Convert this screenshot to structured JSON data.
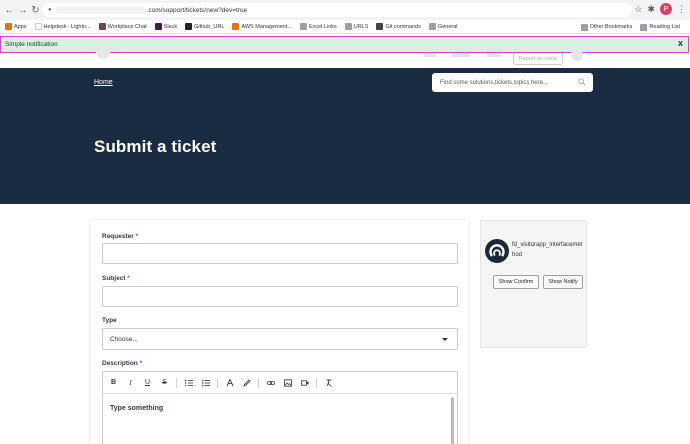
{
  "browser": {
    "url_visible": ".com/support/tickets/new?dev=true",
    "bookmarks": [
      {
        "label": "Apps",
        "icon": "apps-grid-icon",
        "color": "#e8710a"
      },
      {
        "label": "Helpdesk : Lightn...",
        "icon": "site-icon",
        "color": "#ffffff"
      },
      {
        "label": "Workplace Chat",
        "icon": "workplace-icon",
        "color": "#6d4c41"
      },
      {
        "label": "Slack",
        "icon": "slack-icon",
        "color": "#4a154b"
      },
      {
        "label": "Github_URL",
        "icon": "github-icon",
        "color": "#222222"
      },
      {
        "label": "AWS Management...",
        "icon": "aws-icon",
        "color": "#e8710a"
      },
      {
        "label": "Excel Links",
        "icon": "folder-icon",
        "color": "#9aa0a6"
      },
      {
        "label": "URLS",
        "icon": "folder-icon",
        "color": "#9aa0a6"
      },
      {
        "label": "Git commands",
        "icon": "globe-icon",
        "color": "#444444"
      },
      {
        "label": "General",
        "icon": "folder-icon",
        "color": "#9aa0a6"
      }
    ],
    "bookmarks_right": [
      {
        "label": "Other Bookmarks",
        "icon": "folder-icon"
      },
      {
        "label": "Reading List",
        "icon": "reading-list-icon"
      }
    ],
    "profile_initial": "P"
  },
  "notification": {
    "text": "Simple notification",
    "close_label": "x"
  },
  "site": {
    "report_label": "Report an issue"
  },
  "hero": {
    "home_link": "Home",
    "search_placeholder": "Find some solutions,tickets,topics here...",
    "title": "Submit a ticket"
  },
  "form": {
    "requester_label": "Requester",
    "subject_label": "Subject",
    "type_label": "Type",
    "type_selected": "Choose...",
    "description_label": "Description",
    "required_mark": "*",
    "editor_placeholder": "Type something"
  },
  "widget": {
    "name": "fd_visitorapp_interfacemethod",
    "show_confirm": "Show Confirm",
    "show_notify": "Show Notify"
  },
  "colors": {
    "hero_bg": "#1b2b42",
    "notification_bg": "#dbeee2",
    "notification_border": "#d63fd6"
  }
}
